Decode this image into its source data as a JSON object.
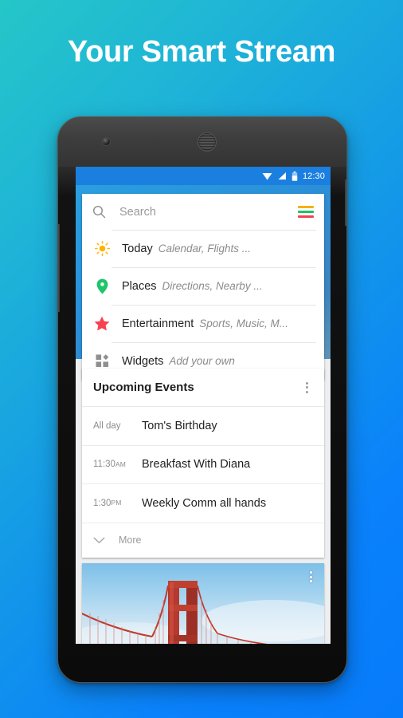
{
  "headline": "Your Smart Stream",
  "colors": {
    "bg_start": "#25c6c8",
    "bg_end": "#077bfb",
    "status_bar": "#1b7fe0",
    "sun_icon": "#ffb300",
    "pin_icon": "#20c46a",
    "star_icon": "#f7414f",
    "widget_icon": "#8f8f8f",
    "burger_line_1": "#f9b000",
    "burger_line_2": "#19c46a",
    "burger_line_3": "#f4414f"
  },
  "statusbar": {
    "time": "12:30",
    "icons": [
      "wifi-icon",
      "signal-icon",
      "battery-icon"
    ]
  },
  "search": {
    "placeholder": "Search",
    "icon": "search-icon",
    "menu_icon": "hamburger-menu-icon"
  },
  "shortcuts": [
    {
      "icon": "sun-icon",
      "title": "Today",
      "subtitle": "Calendar, Flights ..."
    },
    {
      "icon": "map-pin-icon",
      "title": "Places",
      "subtitle": "Directions, Nearby ..."
    },
    {
      "icon": "star-icon",
      "title": "Entertainment",
      "subtitle": "Sports, Music, M..."
    },
    {
      "icon": "widgets-icon",
      "title": "Widgets",
      "subtitle": "Add your own"
    }
  ],
  "events_card": {
    "title": "Upcoming Events",
    "overflow_icon": "more-vertical-icon",
    "rows": [
      {
        "time": "All day",
        "meridiem": "",
        "name": "Tom's Birthday"
      },
      {
        "time": "11:30",
        "meridiem": "AM",
        "name": "Breakfast With Diana"
      },
      {
        "time": "1:30",
        "meridiem": "PM",
        "name": "Weekly Comm all hands"
      }
    ],
    "more_label": "More",
    "more_icon": "chevron-down-icon"
  },
  "photo_card": {
    "alt": "golden-gate-bridge-photo",
    "overflow_icon": "more-vertical-icon"
  },
  "device": {
    "camera": "front-camera",
    "speaker": "earpiece-speaker",
    "volume_button": "volume-rocker",
    "power_button": "power-button"
  }
}
